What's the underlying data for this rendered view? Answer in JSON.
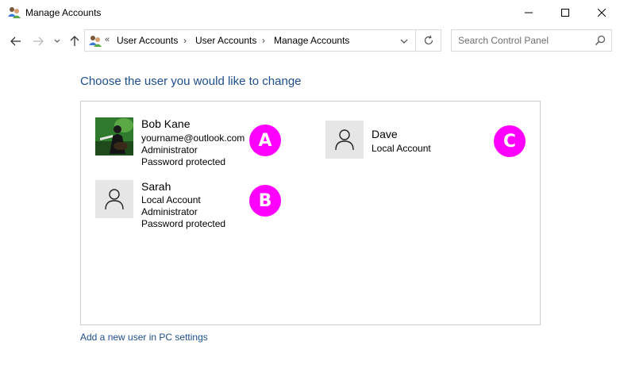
{
  "window": {
    "title": "Manage Accounts"
  },
  "nav": {
    "breadcrumb": [
      "User Accounts",
      "User Accounts",
      "Manage Accounts"
    ],
    "overflow_chevron": "«",
    "separator": "›"
  },
  "search": {
    "placeholder": "Search Control Panel"
  },
  "main": {
    "heading": "Choose the user you would like to change",
    "accounts": [
      {
        "name": "Bob Kane",
        "lines": [
          "yourname@outlook.com",
          "Administrator",
          "Password protected"
        ],
        "avatar": "photo",
        "marker": "A"
      },
      {
        "name": "Sarah",
        "lines": [
          "Local Account",
          "Administrator",
          "Password protected"
        ],
        "avatar": "generic-user-icon",
        "marker": "B"
      },
      {
        "name": "Dave",
        "lines": [
          "Local Account"
        ],
        "avatar": "generic-user-icon",
        "marker": "C"
      }
    ],
    "add_user_link": "Add a new user in PC settings"
  },
  "colors": {
    "link_blue": "#1e4e8c",
    "marker_magenta": "#ff00ff",
    "tile_gray": "#e6e6e6",
    "border": "#cccccc"
  }
}
